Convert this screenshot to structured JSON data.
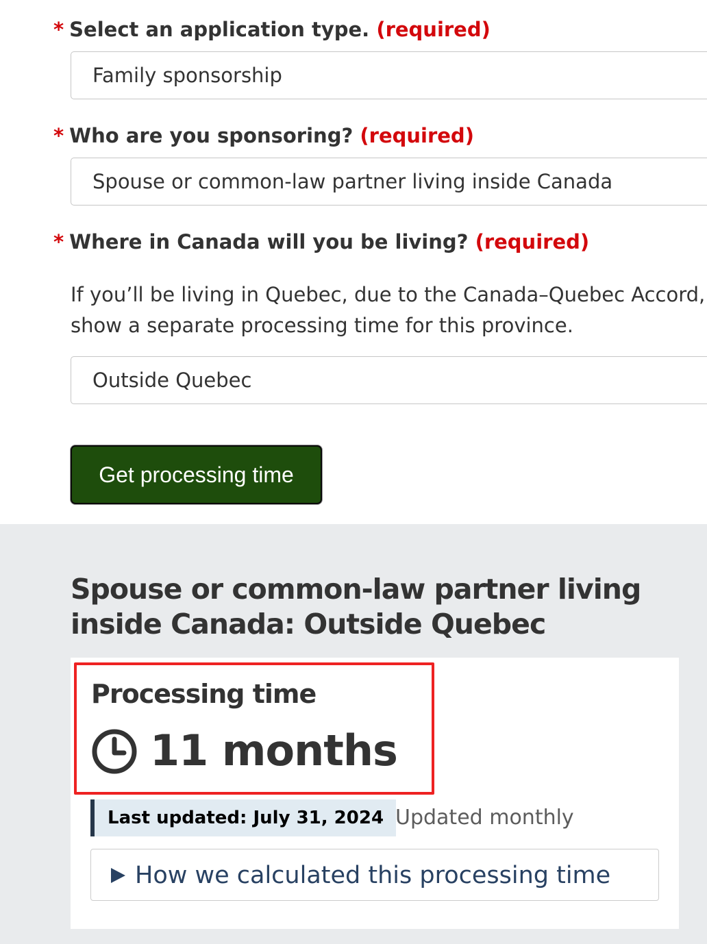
{
  "form": {
    "required_marker": "*",
    "application_type": {
      "label": "Select an application type.",
      "required_text": "(required)",
      "selected": "Family sponsorship"
    },
    "sponsoring": {
      "label": "Who are you sponsoring?",
      "required_text": "(required)",
      "selected": "Spouse or common-law partner living inside Canada"
    },
    "location": {
      "label": "Where in Canada will you be living?",
      "required_text": "(required)",
      "help_line_1": "If you’ll be living in Quebec, due to the Canada–Quebec Accord,",
      "help_line_2": "show a separate processing time for this province.",
      "selected": "Outside Quebec"
    },
    "submit_label": "Get processing time"
  },
  "result": {
    "heading": "Spouse or common-law partner living inside Canada: Outside Quebec",
    "processing_label": "Processing time",
    "processing_value": "11 months",
    "last_updated": "Last updated: July 31, 2024",
    "update_frequency": "Updated monthly",
    "details_summary": "How we calculated this processing time",
    "icons": [
      "clock-icon",
      "triangle-right-icon"
    ],
    "colors": {
      "required": "#d3080c",
      "button_bg": "#1e4d0c",
      "highlight_border": "#ee2222",
      "badge_bg": "#e1ebf2",
      "badge_border": "#26374a",
      "link": "#284162",
      "results_bg": "#e9ebed"
    }
  }
}
